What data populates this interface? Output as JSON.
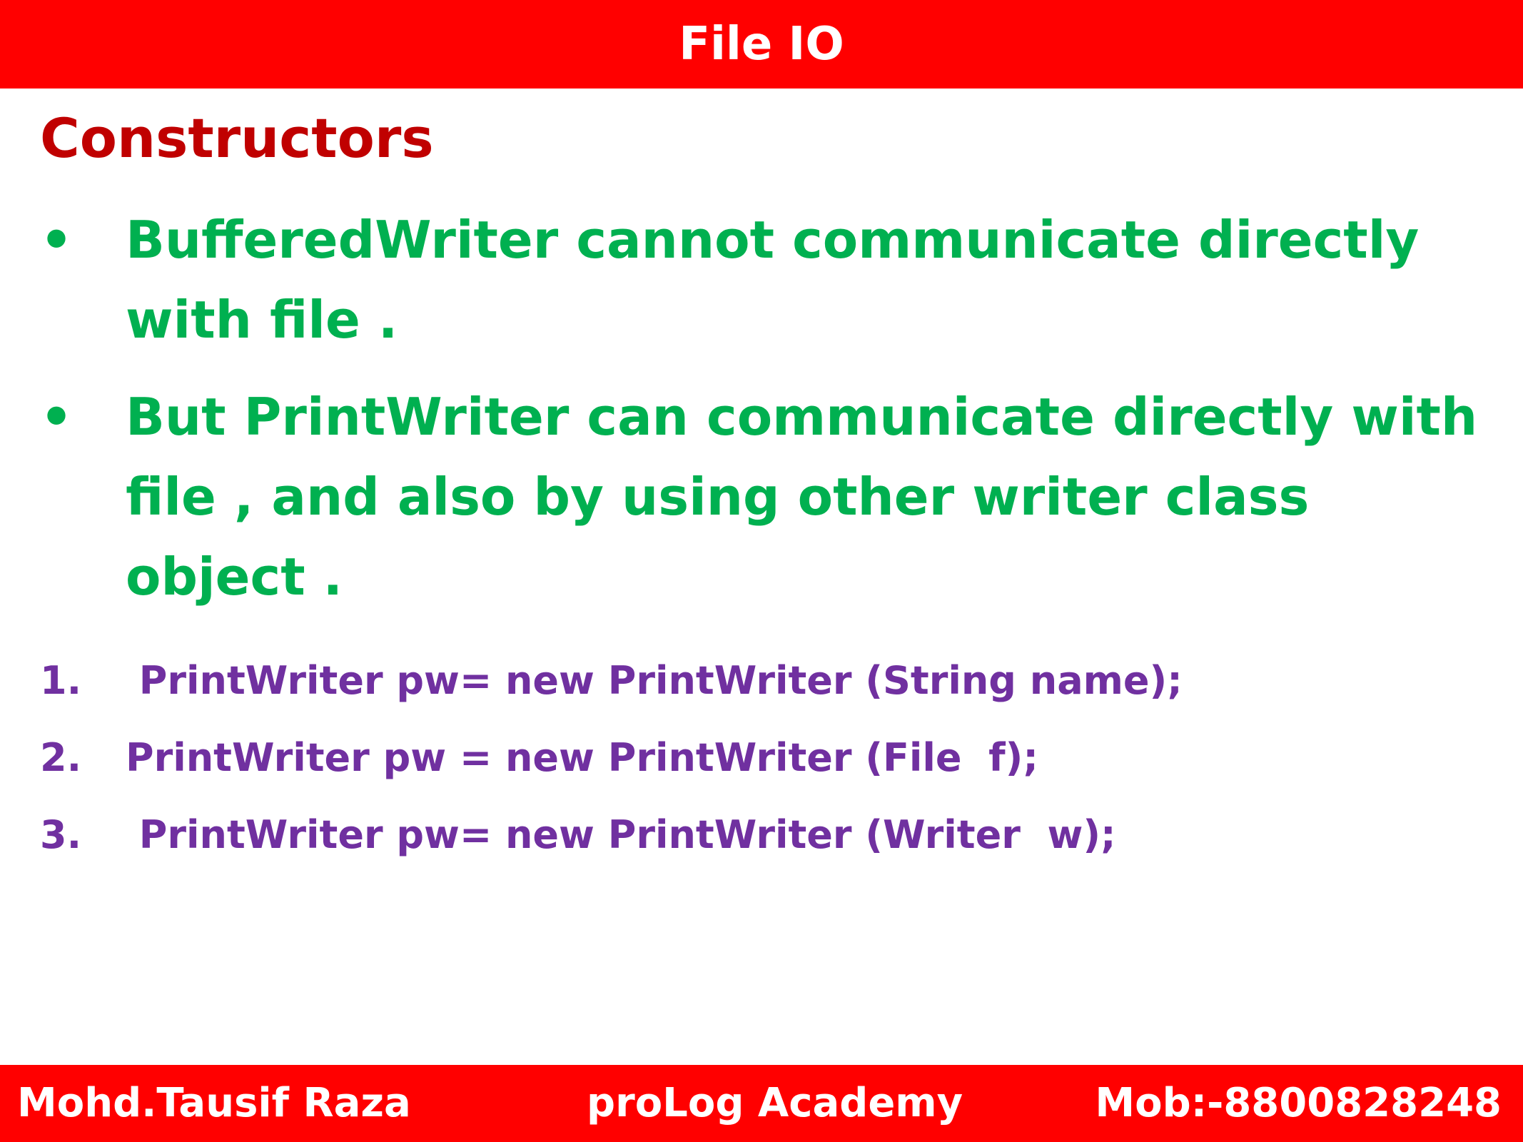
{
  "header": {
    "title": "File IO",
    "color": "#ff0000"
  },
  "section_title": "Constructors",
  "bullets": [
    {
      "marker": "•",
      "text": "BufferedWriter cannot communicate directly with file ."
    },
    {
      "marker": "•",
      "text": "But PrintWriter can communicate directly with file , and also by using other writer class object ."
    }
  ],
  "code_list": [
    {
      "number": "1.",
      "text": " PrintWriter pw= new PrintWriter (String name);"
    },
    {
      "number": "2.",
      "text": "PrintWriter pw = new PrintWriter (File  f);"
    },
    {
      "number": "3.",
      "text": " PrintWriter pw= new PrintWriter (Writer  w);"
    }
  ],
  "footer": {
    "left": "Mohd.Tausif Raza",
    "center": "proLog Academy",
    "right": "Mob:-8800828248"
  },
  "colors": {
    "title": "#c00000",
    "bullet_text": "#00b050",
    "code_text": "#7030a0"
  }
}
